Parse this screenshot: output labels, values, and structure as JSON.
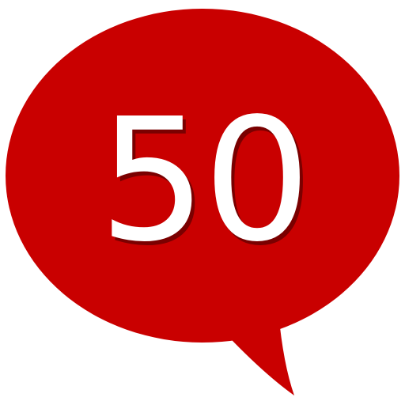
{
  "icon": {
    "name": "speech-bubble-icon",
    "number": "50",
    "colors": {
      "bubble": "#c90000",
      "number": "#ffffff",
      "number_shadow": "#3a0000"
    }
  }
}
